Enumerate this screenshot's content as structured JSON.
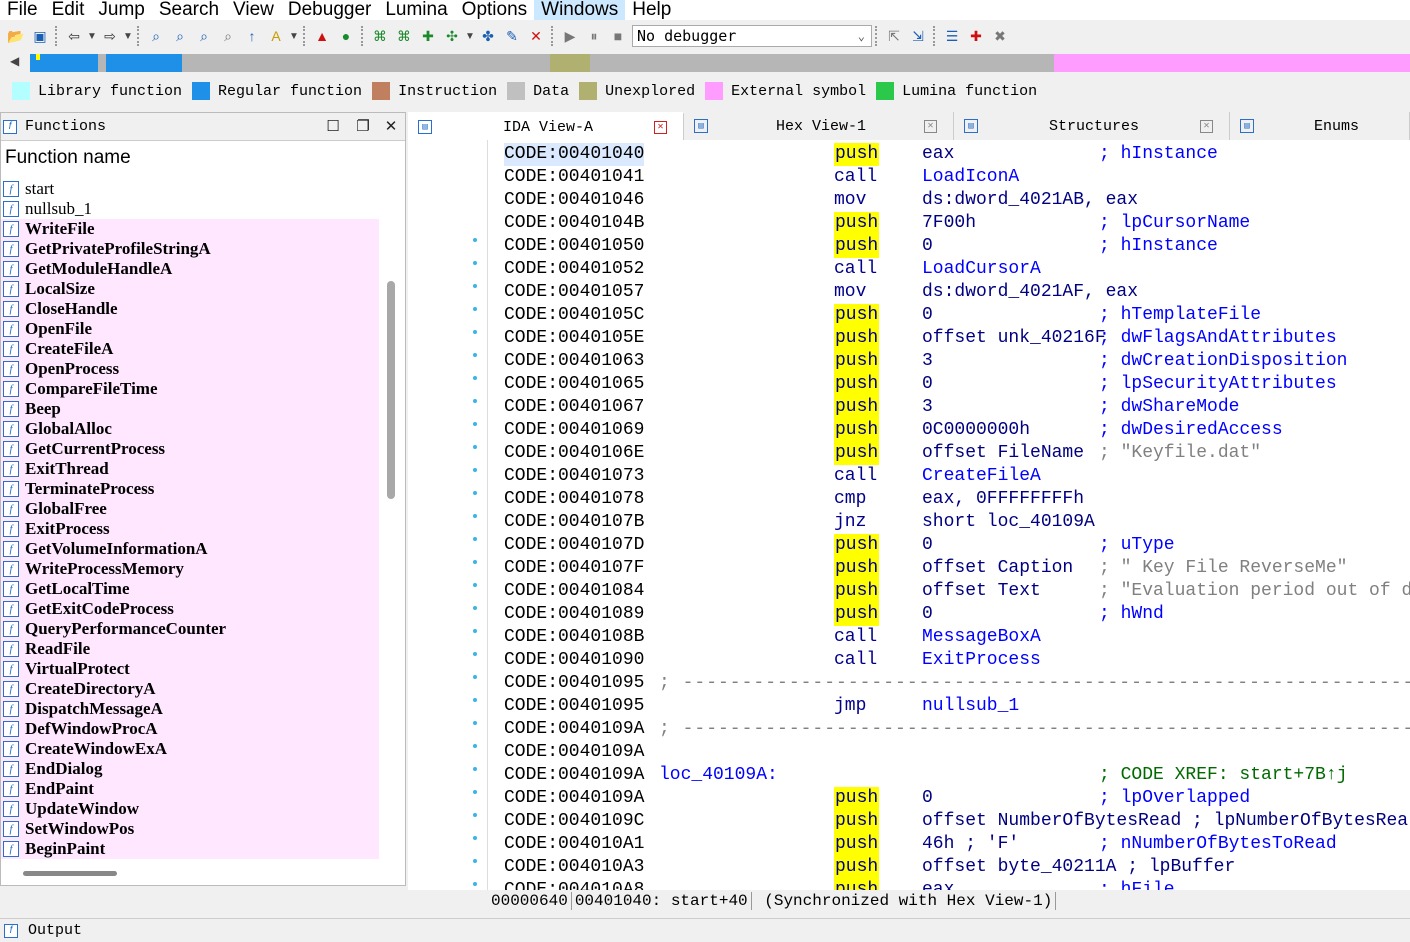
{
  "menu": [
    "File",
    "Edit",
    "Jump",
    "Search",
    "View",
    "Debugger",
    "Lumina",
    "Options",
    "Windows",
    "Help"
  ],
  "toolbar": {
    "debugger_value": "No debugger"
  },
  "legend": [
    {
      "label": "Library function",
      "color": "#b3ffff"
    },
    {
      "label": "Regular function",
      "color": "#1e90e8"
    },
    {
      "label": "Instruction",
      "color": "#c08060"
    },
    {
      "label": "Data",
      "color": "#c0c0c0"
    },
    {
      "label": "Unexplored",
      "color": "#b0b070"
    },
    {
      "label": "External symbol",
      "color": "#ff9cff"
    },
    {
      "label": "Lumina function",
      "color": "#2cc84c"
    }
  ],
  "functions_panel": {
    "title": "Functions",
    "column_header": "Function name",
    "items": [
      {
        "name": "start",
        "type": "regular"
      },
      {
        "name": "nullsub_1",
        "type": "regular"
      },
      {
        "name": "WriteFile",
        "type": "external"
      },
      {
        "name": "GetPrivateProfileStringA",
        "type": "external"
      },
      {
        "name": "GetModuleHandleA",
        "type": "external"
      },
      {
        "name": "LocalSize",
        "type": "external"
      },
      {
        "name": "CloseHandle",
        "type": "external"
      },
      {
        "name": "OpenFile",
        "type": "external"
      },
      {
        "name": "CreateFileA",
        "type": "external"
      },
      {
        "name": "OpenProcess",
        "type": "external"
      },
      {
        "name": "CompareFileTime",
        "type": "external"
      },
      {
        "name": "Beep",
        "type": "external"
      },
      {
        "name": "GlobalAlloc",
        "type": "external"
      },
      {
        "name": "GetCurrentProcess",
        "type": "external"
      },
      {
        "name": "ExitThread",
        "type": "external"
      },
      {
        "name": "TerminateProcess",
        "type": "external"
      },
      {
        "name": "GlobalFree",
        "type": "external"
      },
      {
        "name": "ExitProcess",
        "type": "external"
      },
      {
        "name": "GetVolumeInformationA",
        "type": "external"
      },
      {
        "name": "WriteProcessMemory",
        "type": "external"
      },
      {
        "name": "GetLocalTime",
        "type": "external"
      },
      {
        "name": "GetExitCodeProcess",
        "type": "external"
      },
      {
        "name": "QueryPerformanceCounter",
        "type": "external"
      },
      {
        "name": "ReadFile",
        "type": "external"
      },
      {
        "name": "VirtualProtect",
        "type": "external"
      },
      {
        "name": "CreateDirectoryA",
        "type": "external"
      },
      {
        "name": "DispatchMessageA",
        "type": "external"
      },
      {
        "name": "DefWindowProcA",
        "type": "external"
      },
      {
        "name": "CreateWindowExA",
        "type": "external"
      },
      {
        "name": "EndDialog",
        "type": "external"
      },
      {
        "name": "EndPaint",
        "type": "external"
      },
      {
        "name": "UpdateWindow",
        "type": "external"
      },
      {
        "name": "SetWindowPos",
        "type": "external"
      },
      {
        "name": "BeginPaint",
        "type": "external"
      }
    ]
  },
  "tabs": [
    {
      "label": "IDA View-A",
      "active": true
    },
    {
      "label": "Hex View-1",
      "active": false
    },
    {
      "label": "Structures",
      "active": false
    },
    {
      "label": "Enums",
      "active": false
    }
  ],
  "disasm": [
    {
      "addr": "CODE:00401040",
      "mn": "push",
      "op": "eax",
      "cmt": "; hInstance",
      "cursor": true
    },
    {
      "addr": "CODE:00401041",
      "mn": "call",
      "op": "LoadIconA",
      "opname": true
    },
    {
      "addr": "CODE:00401046",
      "mn": "mov",
      "op": "ds:dword_4021AB, eax"
    },
    {
      "addr": "CODE:0040104B",
      "mn": "push",
      "op": "7F00h",
      "cmt": "; lpCursorName"
    },
    {
      "addr": "CODE:00401050",
      "mn": "push",
      "op": "0",
      "cmt": "; hInstance"
    },
    {
      "addr": "CODE:00401052",
      "mn": "call",
      "op": "LoadCursorA",
      "opname": true
    },
    {
      "addr": "CODE:00401057",
      "mn": "mov",
      "op": "ds:dword_4021AF, eax"
    },
    {
      "addr": "CODE:0040105C",
      "mn": "push",
      "op": "0",
      "cmt": "; hTemplateFile"
    },
    {
      "addr": "CODE:0040105E",
      "mn": "push",
      "op": "offset unk_40216F",
      "cmt": "; dwFlagsAndAttributes"
    },
    {
      "addr": "CODE:00401063",
      "mn": "push",
      "op": "3",
      "cmt": "; dwCreationDisposition"
    },
    {
      "addr": "CODE:00401065",
      "mn": "push",
      "op": "0",
      "cmt": "; lpSecurityAttributes"
    },
    {
      "addr": "CODE:00401067",
      "mn": "push",
      "op": "3",
      "cmt": "; dwShareMode"
    },
    {
      "addr": "CODE:00401069",
      "mn": "push",
      "op": "0C0000000h",
      "cmt": "; dwDesiredAccess"
    },
    {
      "addr": "CODE:0040106E",
      "mn": "push",
      "op": "offset FileName",
      "cmt": "; \"Keyfile.dat\"",
      "gray": true
    },
    {
      "addr": "CODE:00401073",
      "mn": "call",
      "op": "CreateFileA",
      "opname": true
    },
    {
      "addr": "CODE:00401078",
      "mn": "cmp",
      "op": "eax, 0FFFFFFFFh"
    },
    {
      "addr": "CODE:0040107B",
      "mn": "jnz",
      "op": "short loc_40109A"
    },
    {
      "addr": "CODE:0040107D",
      "mn": "push",
      "op": "0",
      "cmt": "; uType"
    },
    {
      "addr": "CODE:0040107F",
      "mn": "push",
      "op": "offset Caption",
      "cmt": "; \" Key File ReverseMe\"",
      "gray": true
    },
    {
      "addr": "CODE:00401084",
      "mn": "push",
      "op": "offset Text",
      "cmt": "; \"Evaluation period out of d",
      "gray": true
    },
    {
      "addr": "CODE:00401089",
      "mn": "push",
      "op": "0",
      "cmt": "; hWnd"
    },
    {
      "addr": "CODE:0040108B",
      "mn": "call",
      "op": "MessageBoxA",
      "opname": true
    },
    {
      "addr": "CODE:00401090",
      "mn": "call",
      "op": "ExitProcess",
      "opname": true
    },
    {
      "addr": "CODE:00401095",
      "sep": "; ---------------------------------------------------------------------------"
    },
    {
      "addr": "CODE:00401095",
      "mn": "jmp",
      "op": "nullsub_1",
      "opname": true
    },
    {
      "addr": "CODE:0040109A",
      "sep": "; ---------------------------------------------------------------------------"
    },
    {
      "addr": "CODE:0040109A"
    },
    {
      "addr": "CODE:0040109A",
      "label": "loc_40109A:",
      "cmt": "; CODE XREF: start+7B↑j",
      "xref": true
    },
    {
      "addr": "CODE:0040109A",
      "mn": "push",
      "op": "0",
      "cmt": "; lpOverlapped"
    },
    {
      "addr": "CODE:0040109C",
      "mn": "push",
      "op": "offset NumberOfBytesRead ; lpNumberOfBytesRea"
    },
    {
      "addr": "CODE:004010A1",
      "mn": "push",
      "op": "46h ; 'F'",
      "cmt": "; nNumberOfBytesToRead"
    },
    {
      "addr": "CODE:004010A3",
      "mn": "push",
      "op": "offset byte_40211A ; lpBuffer"
    },
    {
      "addr": "CODE:004010A8",
      "mn": "push",
      "op": "eax",
      "cmt": "; hFile"
    }
  ],
  "status": {
    "offset": "00000640",
    "location": "00401040: start+40",
    "sync": "(Synchronized with Hex View-1)"
  },
  "output": {
    "title": "Output"
  }
}
